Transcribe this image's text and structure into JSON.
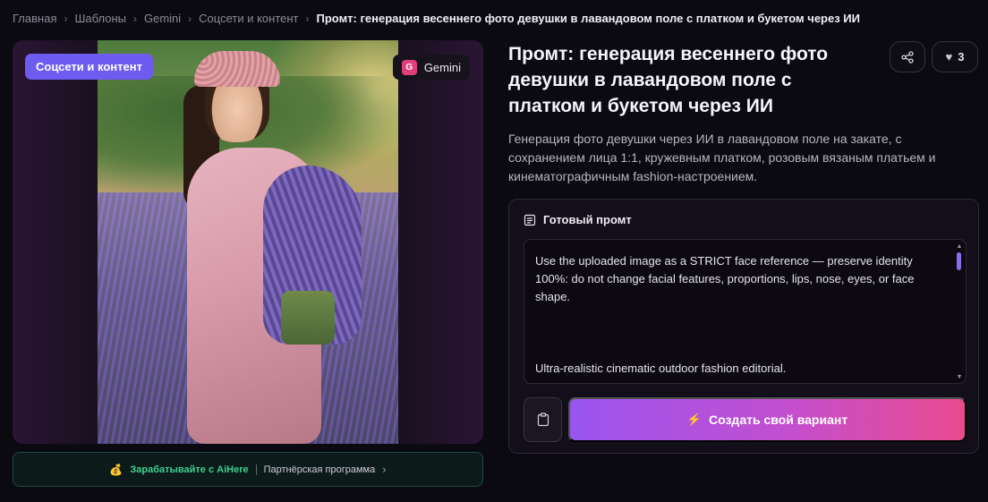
{
  "breadcrumb": {
    "items": [
      "Главная",
      "Шаблоны",
      "Gemini",
      "Соцсети и контент"
    ],
    "current": "Промт: генерация весеннего фото девушки в лавандовом поле с платком и букетом через ИИ",
    "separator": "›"
  },
  "image_card": {
    "category_badge": "Соцсети и контент",
    "model_badge": {
      "icon_letter": "G",
      "label": "Gemini"
    }
  },
  "earn_bar": {
    "icon": "coin-icon",
    "earn_label": "Зарабатывайте с AiHere",
    "partner_label": "Партнёрская программа",
    "chevron": "›"
  },
  "header": {
    "title": "Промт: генерация весеннего фото девушки в лавандовом поле с платком и букетом через ИИ",
    "like_count": "3"
  },
  "description": "Генерация фото девушки через ИИ в лавандовом поле на закате, с сохранением лица 1:1, кружевным платком, розовым вязаным платьем и кинематографичным fashion-настроением.",
  "prompt": {
    "heading": "Готовый промт",
    "text": "Use the uploaded image as a STRICT face reference — preserve identity 100%: do not change facial features, proportions, lips, nose, eyes, or face shape.\n\n\n\nUltra-realistic cinematic outdoor fashion editorial."
  },
  "actions": {
    "create_label": "Создать свой вариант"
  },
  "colors": {
    "accent_badge": "#6e5cf0",
    "earn_green": "#3fd08f",
    "button_gradient_start": "#9a55f0",
    "button_gradient_end": "#e94a8e"
  }
}
